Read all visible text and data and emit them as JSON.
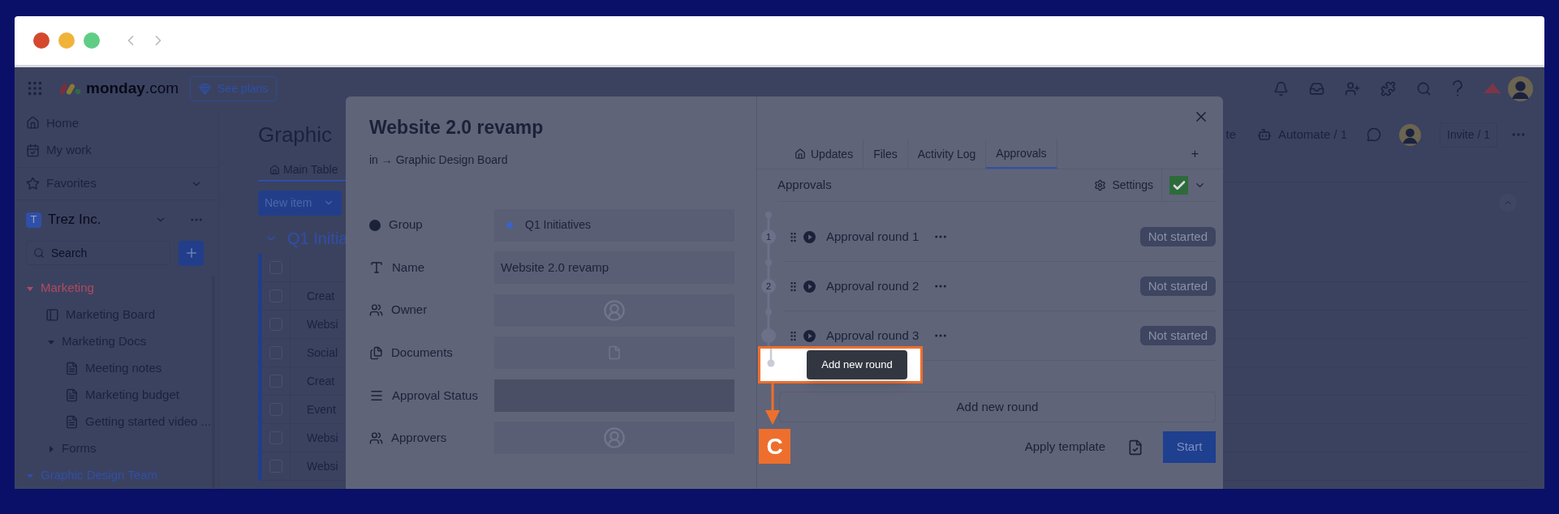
{
  "app_header": {
    "logo": "**monday**.com",
    "plans_button": "See plans"
  },
  "sidebar": {
    "nav": [
      {
        "label": "Home"
      },
      {
        "label": "My work"
      }
    ],
    "favorites": {
      "label": "Favorites",
      "expanded": false
    },
    "workspace": {
      "badge": "T",
      "name": "Trez Inc."
    },
    "search": {
      "placeholder": "Search"
    },
    "tree": [
      {
        "label": "Marketing",
        "kind": "folder",
        "expanded": true,
        "color": "#b04a60",
        "children": [
          {
            "label": "Marketing Board",
            "kind": "board"
          },
          {
            "label": "Marketing Docs",
            "kind": "folder",
            "expanded": true,
            "children": [
              {
                "label": "Meeting notes",
                "kind": "doc"
              },
              {
                "label": "Marketing budget",
                "kind": "doc"
              },
              {
                "label": "Getting started video ...",
                "kind": "doc"
              }
            ]
          },
          {
            "label": "Forms",
            "kind": "folder",
            "expanded": false
          }
        ]
      },
      {
        "label": "Graphic Design Team",
        "kind": "folder",
        "expanded": true,
        "color": "#2f4fa8"
      }
    ]
  },
  "board": {
    "title": "Graphic",
    "actions": [
      {
        "label": "te"
      },
      {
        "label": "Automate / 1"
      }
    ],
    "invite": "Invite / 1",
    "view_tabs": [
      {
        "label": "Main Table",
        "selected": true
      }
    ],
    "new_item": "New item",
    "group": {
      "title": "Q1 Initia",
      "expanded": true
    },
    "select_all": {
      "checked": false
    },
    "rows": [
      {
        "label": "Creat",
        "checked": false
      },
      {
        "label": "Websi",
        "checked": false
      },
      {
        "label": "Social",
        "checked": false
      },
      {
        "label": "Creat",
        "checked": false
      },
      {
        "label": "Event",
        "checked": false
      },
      {
        "label": "Websi",
        "checked": false
      },
      {
        "label": "Websi",
        "checked": false
      }
    ]
  },
  "item_panel": {
    "title": "Website 2.0 revamp",
    "breadcrumb": "in → Graphic Design Board",
    "fields": [
      {
        "label": "Group",
        "kind": "group",
        "value": "Q1 Initiatives",
        "color": "#3b63c4"
      },
      {
        "label": "Name",
        "kind": "text",
        "value": "Website 2.0 revamp"
      },
      {
        "label": "Owner",
        "kind": "person"
      },
      {
        "label": "Documents",
        "kind": "file"
      },
      {
        "label": "Approval Status",
        "kind": "status"
      },
      {
        "label": "Approvers",
        "kind": "person"
      }
    ],
    "tabs": [
      {
        "label": "Updates",
        "selected": false
      },
      {
        "label": "Files",
        "selected": false
      },
      {
        "label": "Activity Log",
        "selected": false
      },
      {
        "label": "Approvals",
        "selected": true
      }
    ],
    "add_tab": "+",
    "approvals": {
      "title": "Approvals",
      "settings": "Settings",
      "enabled": true,
      "rounds": [
        {
          "number": "1",
          "name": "Approval round 1",
          "status": "Not started"
        },
        {
          "number": "2",
          "name": "Approval round 2",
          "status": "Not started"
        },
        {
          "name": "Approval round 3",
          "status": "Not started"
        }
      ],
      "add_round": "Add new round",
      "apply_template": "Apply template",
      "start": "Start"
    }
  },
  "annotation": {
    "tooltip": "Add new round",
    "badge": "C"
  }
}
